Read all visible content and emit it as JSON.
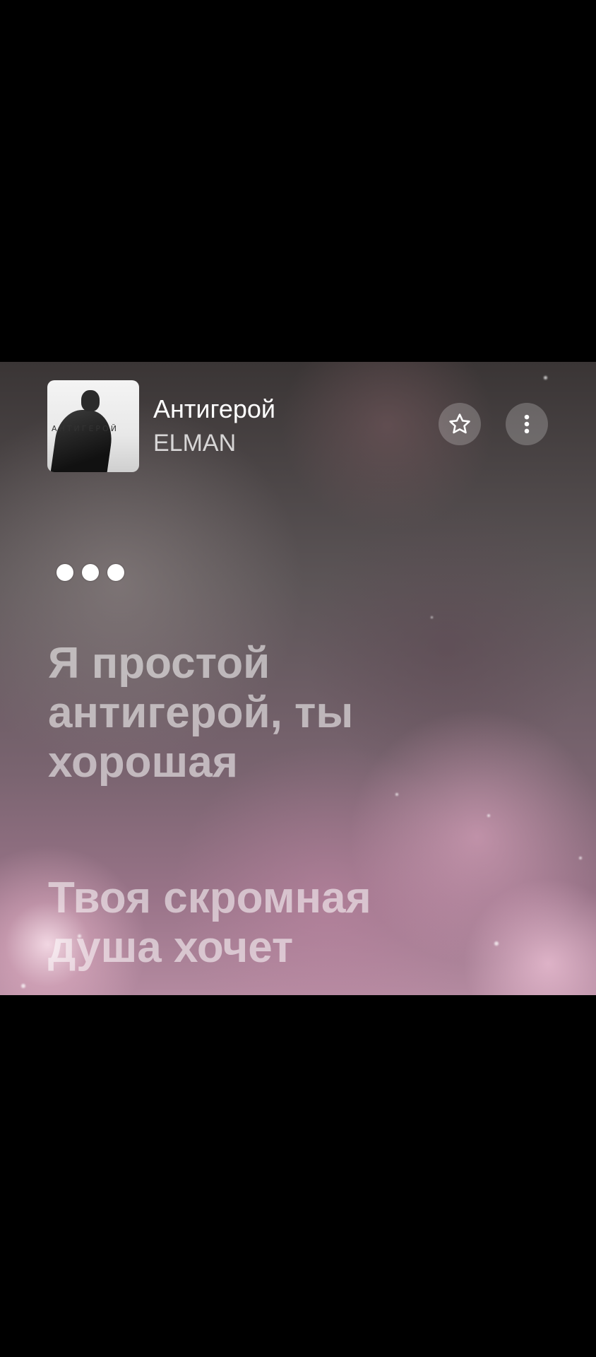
{
  "player": {
    "track_title": "Антигерой",
    "artist": "ELMAN",
    "cover": {
      "alt_text": "АНТИГЕРОЙ"
    },
    "buttons": {
      "favorite_icon": "star-icon",
      "more_icon": "more-vertical-icon"
    }
  },
  "lyrics": {
    "progress_indicator": "three-dots",
    "lines": [
      "Я простой антигерой, ты хорошая",
      "Твоя скромная душа хочет"
    ]
  }
}
